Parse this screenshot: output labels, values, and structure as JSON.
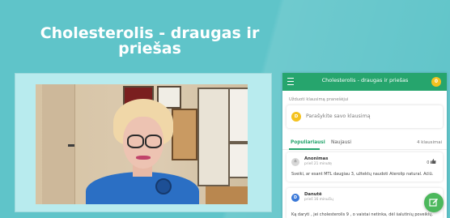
{
  "page": {
    "title": "Cholesterolis - draugas ir priešas"
  },
  "panel": {
    "header_title": "Cholesterolis - draugas ir priešas",
    "coin_label": "0",
    "ask_label": "Užduoti klausimą pranešėjui",
    "ask_avatar": "D",
    "ask_placeholder": "Parašykite savo klausimą",
    "tabs": [
      {
        "label": "Populiariausi",
        "active": true
      },
      {
        "label": "Naujausi",
        "active": false
      }
    ],
    "question_count": "4 klausimai",
    "questions": [
      {
        "author": "Anonimas",
        "time": "prieš 21 minutę",
        "likes": "0",
        "text": "Sveiki, ar esant MTL daugiau 3, užtektų naudoti Aterolip natural. Ačiū.",
        "avatar": "≗"
      },
      {
        "author": "Danutė",
        "time": "prieš 16 minučių",
        "likes": "",
        "text": "Ką daryti , jei cholesterolis 9 , o vaistai netinka, dėl šalutinių poveikių.",
        "avatar": "D"
      }
    ]
  },
  "colors": {
    "background": "#5fc4c9",
    "accent": "#26a56d",
    "coin": "#f4c21f",
    "avatar_blue": "#3a78d8",
    "fab": "#4cb85c"
  },
  "icons": {
    "menu": "hamburger-menu-icon",
    "like": "thumbs-up-icon",
    "fab": "edit-icon"
  }
}
